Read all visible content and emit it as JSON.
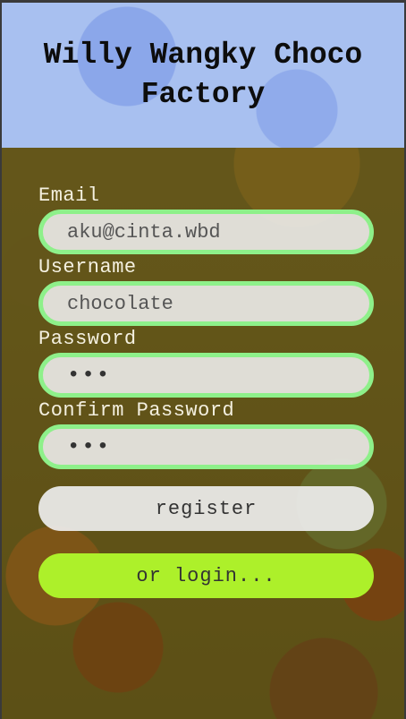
{
  "header": {
    "title": "Willy Wangky Choco Factory"
  },
  "form": {
    "email": {
      "label": "Email",
      "value": "aku@cinta.wbd"
    },
    "username": {
      "label": "Username",
      "value": "chocolate"
    },
    "password": {
      "label": "Password",
      "value": "•••"
    },
    "confirm_password": {
      "label": "Confirm Password",
      "value": "•••"
    },
    "register_label": "register",
    "login_label": "or login..."
  },
  "colors": {
    "header_bg": "#a8c0f0",
    "field_border": "#8ef08a",
    "login_button": "#adf02a"
  }
}
